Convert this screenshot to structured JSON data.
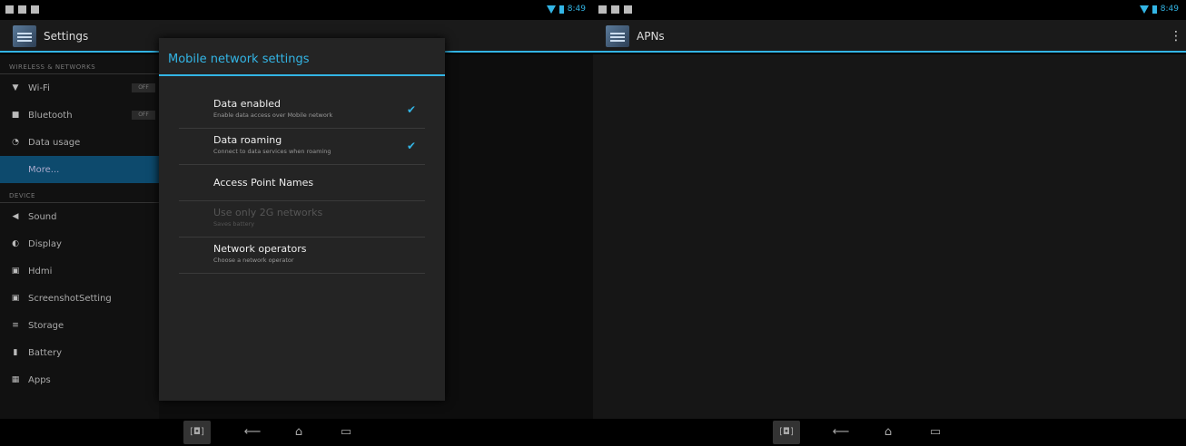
{
  "left": {
    "action_title": "Settings",
    "categories": {
      "wireless": "WIRELESS & NETWORKS",
      "device": "DEVICE"
    },
    "wireless_items": [
      {
        "label": "Wi-Fi",
        "icon": "wifi-icon",
        "toggle": "OFF"
      },
      {
        "label": "Bluetooth",
        "icon": "bluetooth-icon",
        "toggle": "OFF"
      },
      {
        "label": "Data usage",
        "icon": "data-usage-icon"
      },
      {
        "label": "More...",
        "icon": "",
        "selected": true
      }
    ],
    "device_items": [
      {
        "label": "Sound",
        "icon": "sound-icon"
      },
      {
        "label": "Display",
        "icon": "display-icon"
      },
      {
        "label": "Hdmi",
        "icon": "hdmi-icon"
      },
      {
        "label": "ScreenshotSetting",
        "icon": "screenshot-icon"
      },
      {
        "label": "Storage",
        "icon": "storage-icon"
      },
      {
        "label": "Battery",
        "icon": "battery-icon"
      },
      {
        "label": "Apps",
        "icon": "apps-icon"
      }
    ],
    "status_time": "8:49"
  },
  "dialog": {
    "title": "Mobile network settings",
    "items": [
      {
        "title": "Data enabled",
        "summary": "Enable data access over Mobile network",
        "checked": true
      },
      {
        "title": "Data roaming",
        "summary": "Connect to data services when roaming",
        "checked": true
      },
      {
        "title": "Access Point Names",
        "summary": ""
      },
      {
        "title": "Use only 2G networks",
        "summary": "Saves battery",
        "disabled": true
      },
      {
        "title": "Network operators",
        "summary": "Choose a network operator"
      }
    ]
  },
  "right": {
    "action_title": "APNs",
    "status_time": "8:49"
  },
  "colors": {
    "accent": "#33b5e5",
    "background": "#000000",
    "dialog": "#242424"
  }
}
